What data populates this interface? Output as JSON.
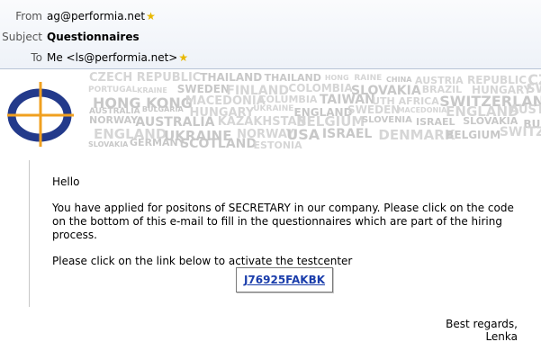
{
  "header": {
    "from_label": "From",
    "from_value": "ag@performia.net",
    "subject_label": "Subject",
    "subject_value": "Questionnaires",
    "to_label": "To",
    "to_value": "Me <ls@performia.net>"
  },
  "banner": {
    "words": [
      "CZECH REPUBLIC",
      "THAILAND",
      "THAILAND",
      "HONG",
      "RAINE",
      "CHINA",
      "AUSTRIA",
      "REPUBLIC",
      "CZECH REPUBLIC",
      "PORTUGAL",
      "KRAINE",
      "SWEDEN",
      "FINLAND",
      "COLOMBIA",
      "SLOVAKIA",
      "BRAZIL",
      "HUNGARY",
      "SWEDEN",
      "HONG KONG",
      "MACEDONIA",
      "COLUMBIA",
      "TAIWAN",
      "UTH AFRICA",
      "SWITZERLAND",
      "AUSTRALIA",
      "BULGARIA",
      "HUNGARY",
      "UKRAINE",
      "ENGLAND",
      "SWEDEN",
      "MACEDONIA",
      "ENGLAND",
      "AUSTRALIA",
      "NORWAY",
      "AUSTRALIA",
      "KAZAKHSTAN",
      "BELGIUM",
      "SLOVENIA",
      "ISRAEL",
      "SLOVAKIA",
      "BULGARIA",
      "ENGLAND",
      "UKRAINE",
      "NORWAY",
      "USA",
      "ISRAEL",
      "DENMARK",
      "BELGIUM",
      "SWITZERLAND",
      "SLOVAKIA",
      "GERMANY",
      "SCOTLAND",
      "ESTONIA"
    ]
  },
  "body": {
    "greeting": "Hello",
    "paragraph1": "You have applied for positons of SECRETARY in our company. Please click on the code on the bottom of this e-mail to fill in the questionnaires which are part of the hiring process.",
    "paragraph2": "Please click on the link below to activate the testcenter",
    "code_link": "J76925FAKBK",
    "closing": "Best regards,",
    "signature": "Lenka"
  },
  "colors": {
    "header_bg": "#eef2f8",
    "link": "#1a3dab",
    "logo_blue": "#233a8b",
    "logo_orange": "#f0a020",
    "star": "#e8b800"
  }
}
